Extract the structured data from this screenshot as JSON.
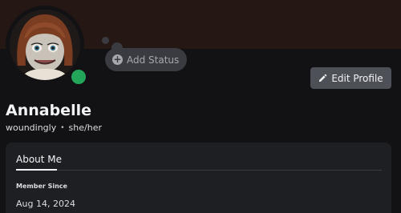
{
  "profile": {
    "display_name": "Annabelle",
    "username": "woundingly",
    "separator": "•",
    "pronouns": "she/her",
    "avatar_icon": "doll-avatar",
    "status_color": "#23a55a"
  },
  "status": {
    "add_label": "Add Status",
    "icon": "plus-circle-icon"
  },
  "actions": {
    "edit_profile_label": "Edit Profile",
    "edit_icon": "pencil-icon"
  },
  "about": {
    "tab_label": "About Me",
    "member_since_label": "Member Since",
    "member_since_value": "Aug 14, 2024"
  },
  "colors": {
    "banner": "#241714",
    "background": "#121214",
    "card": "#1e1f22",
    "button": "#4e5058",
    "online": "#23a55a"
  }
}
